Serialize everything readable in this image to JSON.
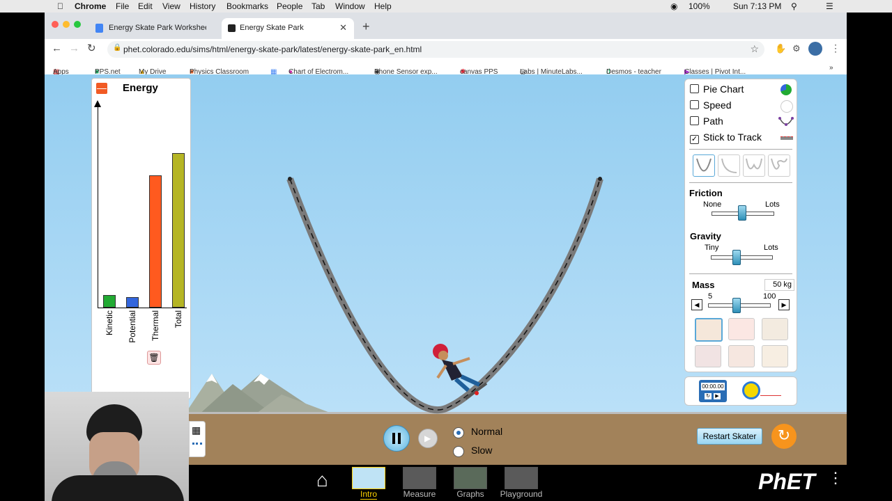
{
  "menubar": {
    "app": "Chrome",
    "items": [
      "File",
      "Edit",
      "View",
      "History",
      "Bookmarks",
      "People",
      "Tab",
      "Window",
      "Help"
    ],
    "battery": "100%",
    "clock": "Sun 7:13 PM"
  },
  "tabs": [
    {
      "title": "Energy Skate Park Worksheet",
      "active": false
    },
    {
      "title": "Energy Skate Park",
      "active": true
    }
  ],
  "address": {
    "url": "phet.colorado.edu/sims/html/energy-skate-park/latest/energy-skate-park_en.html"
  },
  "bookmarks": [
    "Apps",
    "PPS.net",
    "My Drive",
    "Physics Classroom",
    "",
    "Chart of Electrom...",
    "Phone Sensor exp...",
    "canvas PPS",
    "Labs | MinuteLabs...",
    "Desmos - teacher",
    "Classes | Pivot Int..."
  ],
  "energy_panel": {
    "title": "Energy",
    "bars": [
      {
        "label": "Kinetic",
        "value": 0.06,
        "color": "#22aa33"
      },
      {
        "label": "Potential",
        "value": 0.05,
        "color": "#3366dd"
      },
      {
        "label": "Thermal",
        "value": 0.65,
        "color": "#ff5a1f"
      },
      {
        "label": "Total",
        "value": 0.76,
        "color": "#b5b524"
      }
    ]
  },
  "controls": {
    "checkboxes": [
      {
        "label": "Pie Chart",
        "checked": false,
        "icon": "pie-chart-icon"
      },
      {
        "label": "Speed",
        "checked": false,
        "icon": "speedometer-icon"
      },
      {
        "label": "Path",
        "checked": false,
        "icon": "path-icon"
      },
      {
        "label": "Stick to Track",
        "checked": true,
        "icon": "track-icon"
      }
    ],
    "friction": {
      "title": "Friction",
      "min_label": "None",
      "max_label": "Lots",
      "value": 0.5
    },
    "gravity": {
      "title": "Gravity",
      "min_label": "Tiny",
      "max_label": "Lots",
      "value": 0.43
    },
    "mass": {
      "title": "Mass",
      "value_text": "50 kg",
      "min_label": "5",
      "max_label": "100",
      "value": 0.47
    },
    "stopwatch_time": "00:00.00"
  },
  "playback": {
    "speed_options": [
      {
        "label": "Normal",
        "selected": true
      },
      {
        "label": "Slow",
        "selected": false
      }
    ],
    "restart_label": "Restart Skater"
  },
  "nav": {
    "screens": [
      "Intro",
      "Measure",
      "Graphs",
      "Playground"
    ],
    "active": "Intro",
    "brand": "PhET"
  },
  "colors": {
    "sky_top": "#93cdf0",
    "ground": "#a2825a",
    "accent_orange": "#f7941d",
    "nav_active": "#ffd200"
  }
}
